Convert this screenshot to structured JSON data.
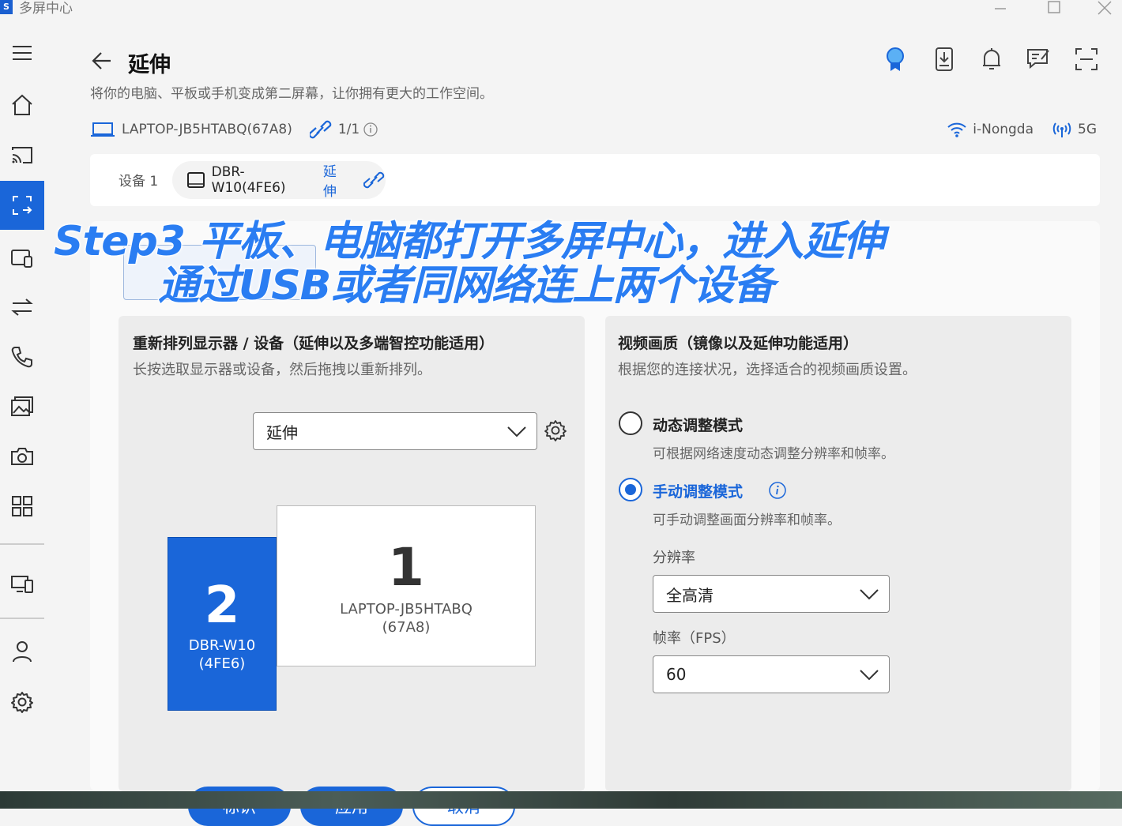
{
  "app": {
    "title": "多屏中心",
    "logo": "S"
  },
  "header": {
    "title": "延伸",
    "subtitle": "将你的电脑、平板或手机变成第二屏幕，让你拥有更大的工作空间。"
  },
  "connection": {
    "local_device": "LAPTOP-JB5HTABQ(67A8)",
    "link_count": "1/1",
    "wifi_name": "i-Nongda",
    "band": "5G"
  },
  "device_card": {
    "label": "设备 1",
    "device_name": "DBR-W10(4FE6)",
    "mode": "延伸"
  },
  "overlay": {
    "line1": "Step3 平板、电脑都打开多屏中心，进入延伸",
    "line2": "通过USB或者同网络连上两个设备"
  },
  "arrange_panel": {
    "title": "重新排列显示器 / 设备（延伸以及多端智控功能适用）",
    "subtitle": "长按选取显示器或设备，然后拖拽以重新排列。",
    "mode_select": "延伸",
    "monitors": [
      {
        "number": "2",
        "name": "DBR-W10",
        "id": "(4FE6)"
      },
      {
        "number": "1",
        "name": "LAPTOP-JB5HTABQ",
        "id": "(67A8)"
      }
    ],
    "buttons": {
      "identify": "标识",
      "apply": "应用",
      "cancel": "取消"
    }
  },
  "quality_panel": {
    "title": "视频画质（镜像以及延伸功能适用）",
    "subtitle": "根据您的连接状况，选择适合的视频画质设置。",
    "dynamic": {
      "label": "动态调整模式",
      "desc": "可根据网络速度动态调整分辨率和帧率。",
      "selected": false
    },
    "manual": {
      "label": "手动调整模式",
      "desc": "可手动调整画面分辨率和帧率。",
      "selected": true
    },
    "resolution_label": "分辨率",
    "resolution_value": "全高清",
    "fps_label": "帧率（FPS）",
    "fps_value": "60"
  },
  "colors": {
    "accent": "#1a66d9",
    "overlay": "#2a7df2"
  }
}
